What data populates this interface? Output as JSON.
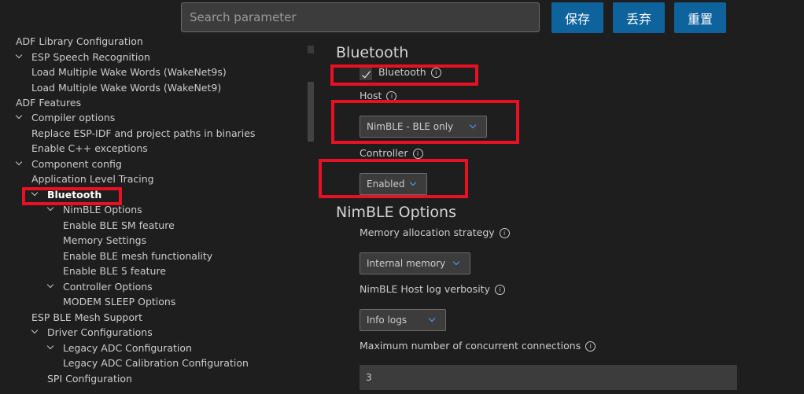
{
  "search": {
    "placeholder": "Search parameter"
  },
  "toolbar": {
    "save_label": "保存",
    "discard_label": "丢弃",
    "reset_label": "重置"
  },
  "tree": [
    {
      "label": "ADF Library Configuration",
      "expanded": false
    },
    {
      "label": "ESP Speech Recognition",
      "expanded": true
    },
    {
      "label": "Load Multiple Wake Words (WakeNet9s)"
    },
    {
      "label": "Load Multiple Wake Words (WakeNet9)"
    },
    {
      "label": "ADF Features"
    },
    {
      "label": "Compiler options",
      "expanded": true
    },
    {
      "label": "Replace ESP-IDF and project paths in binaries"
    },
    {
      "label": "Enable C++ exceptions"
    },
    {
      "label": "Component config",
      "expanded": true
    },
    {
      "label": "Application Level Tracing"
    },
    {
      "label": "Bluetooth",
      "expanded": true,
      "selected": true
    },
    {
      "label": "NimBLE Options",
      "expanded": true
    },
    {
      "label": "Enable BLE SM feature"
    },
    {
      "label": "Memory Settings"
    },
    {
      "label": "Enable BLE mesh functionality"
    },
    {
      "label": "Enable BLE 5 feature"
    },
    {
      "label": "Controller Options",
      "expanded": true
    },
    {
      "label": "MODEM SLEEP Options"
    },
    {
      "label": "ESP BLE Mesh Support"
    },
    {
      "label": "Driver Configurations",
      "expanded": true
    },
    {
      "label": "Legacy ADC Configuration",
      "expanded": true
    },
    {
      "label": "Legacy ADC Calibration Configuration"
    },
    {
      "label": "SPI Configuration"
    }
  ],
  "main": {
    "bluetooth_title": "Bluetooth",
    "bluetooth_checkbox_label": "Bluetooth",
    "bluetooth_checked": true,
    "host_label": "Host",
    "host_value": "NimBLE - BLE only",
    "controller_label": "Controller",
    "controller_value": "Enabled",
    "nimble_title": "NimBLE Options",
    "mem_alloc_label": "Memory allocation strategy",
    "mem_alloc_value": "Internal memory",
    "log_verbosity_label": "NimBLE Host log verbosity",
    "log_verbosity_value": "Info logs",
    "max_conn_label": "Maximum number of concurrent connections",
    "max_conn_value": "3",
    "info_glyph": "i"
  },
  "colors": {
    "background": "#1e1e1e",
    "button": "#0e639c",
    "input_bg": "#3c3c3c",
    "highlight": "#e81123",
    "chevron_accent": "#4da3ff"
  }
}
